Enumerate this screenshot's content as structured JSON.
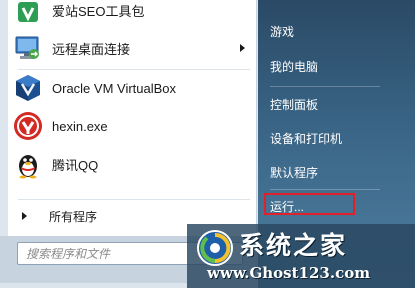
{
  "programs": [
    {
      "label": "爱站SEO工具包",
      "icon": "aizhan-seo-icon",
      "has_submenu": false
    },
    {
      "label": "远程桌面连接",
      "icon": "remote-desktop-icon",
      "has_submenu": true
    },
    {
      "label": "Oracle VM VirtualBox",
      "icon": "virtualbox-icon",
      "has_submenu": false
    },
    {
      "label": "hexin.exe",
      "icon": "hexin-icon",
      "has_submenu": false
    },
    {
      "label": "腾讯QQ",
      "icon": "qq-penguin-icon",
      "has_submenu": false
    }
  ],
  "all_programs_label": "所有程序",
  "search": {
    "placeholder": "搜索程序和文件"
  },
  "right_items": [
    {
      "label": "游戏"
    },
    {
      "label": "我的电脑"
    },
    {
      "label": "控制面板"
    },
    {
      "label": "设备和打印机"
    },
    {
      "label": "默认程序"
    },
    {
      "label": "运行..."
    }
  ],
  "highlighted_item": "运行...",
  "highlight_color": "#e0202a",
  "watermark": {
    "title": "系统之家",
    "url": "www.Ghost123.com"
  }
}
